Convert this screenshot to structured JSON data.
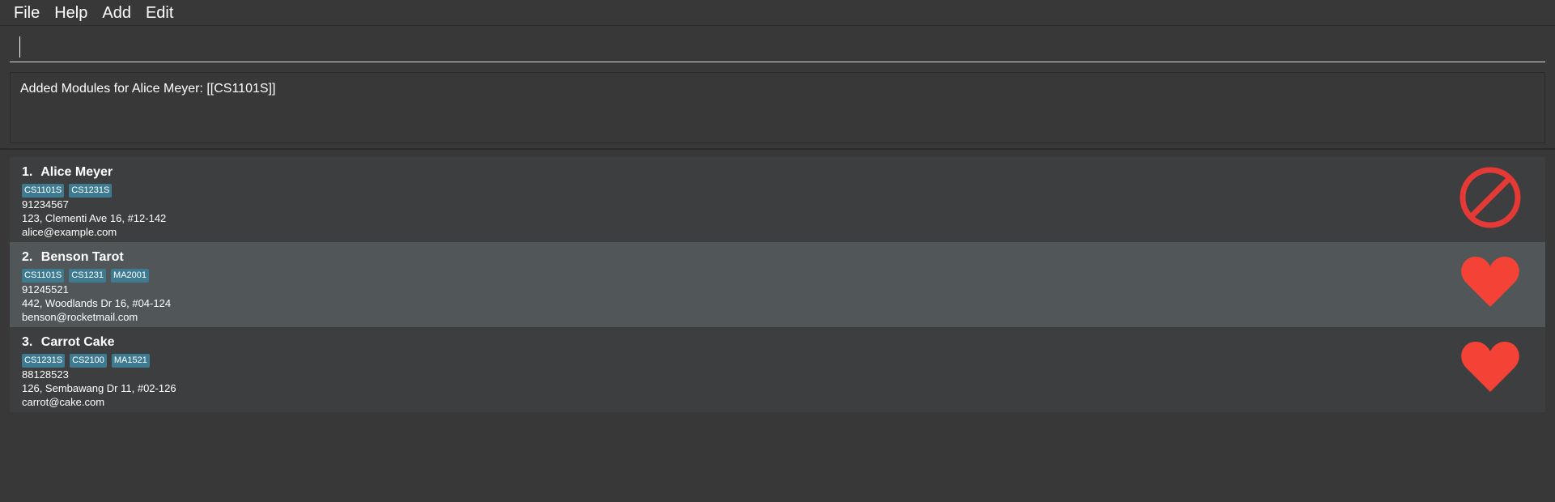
{
  "menu": {
    "items": [
      "File",
      "Help",
      "Add",
      "Edit"
    ]
  },
  "command": {
    "value": "",
    "placeholder": ""
  },
  "result": {
    "message": "Added Modules for Alice Meyer: [[CS1101S]]"
  },
  "persons": [
    {
      "index": "1.",
      "name": "Alice Meyer",
      "tags": [
        "CS1101S",
        "CS1231S"
      ],
      "phone": "91234567",
      "address": "123, Clementi Ave 16, #12-142",
      "email": "alice@example.com",
      "status_icon": "no-entry-icon"
    },
    {
      "index": "2.",
      "name": "Benson Tarot",
      "tags": [
        "CS1101S",
        "CS1231",
        "MA2001"
      ],
      "phone": "91245521",
      "address": "442, Woodlands Dr 16, #04-124",
      "email": "benson@rocketmail.com",
      "status_icon": "heart-icon"
    },
    {
      "index": "3.",
      "name": "Carrot Cake",
      "tags": [
        "CS1231S",
        "CS2100",
        "MA1521"
      ],
      "phone": "88128523",
      "address": "126, Sembawang Dr 11, #02-126",
      "email": "carrot@cake.com",
      "status_icon": "heart-icon"
    }
  ],
  "colors": {
    "background": "#383838",
    "selected_card": "#515658",
    "card": "#3c3e3f",
    "tag": "#3e7b91",
    "heart": "#f44336",
    "no_entry": "#e53935"
  }
}
